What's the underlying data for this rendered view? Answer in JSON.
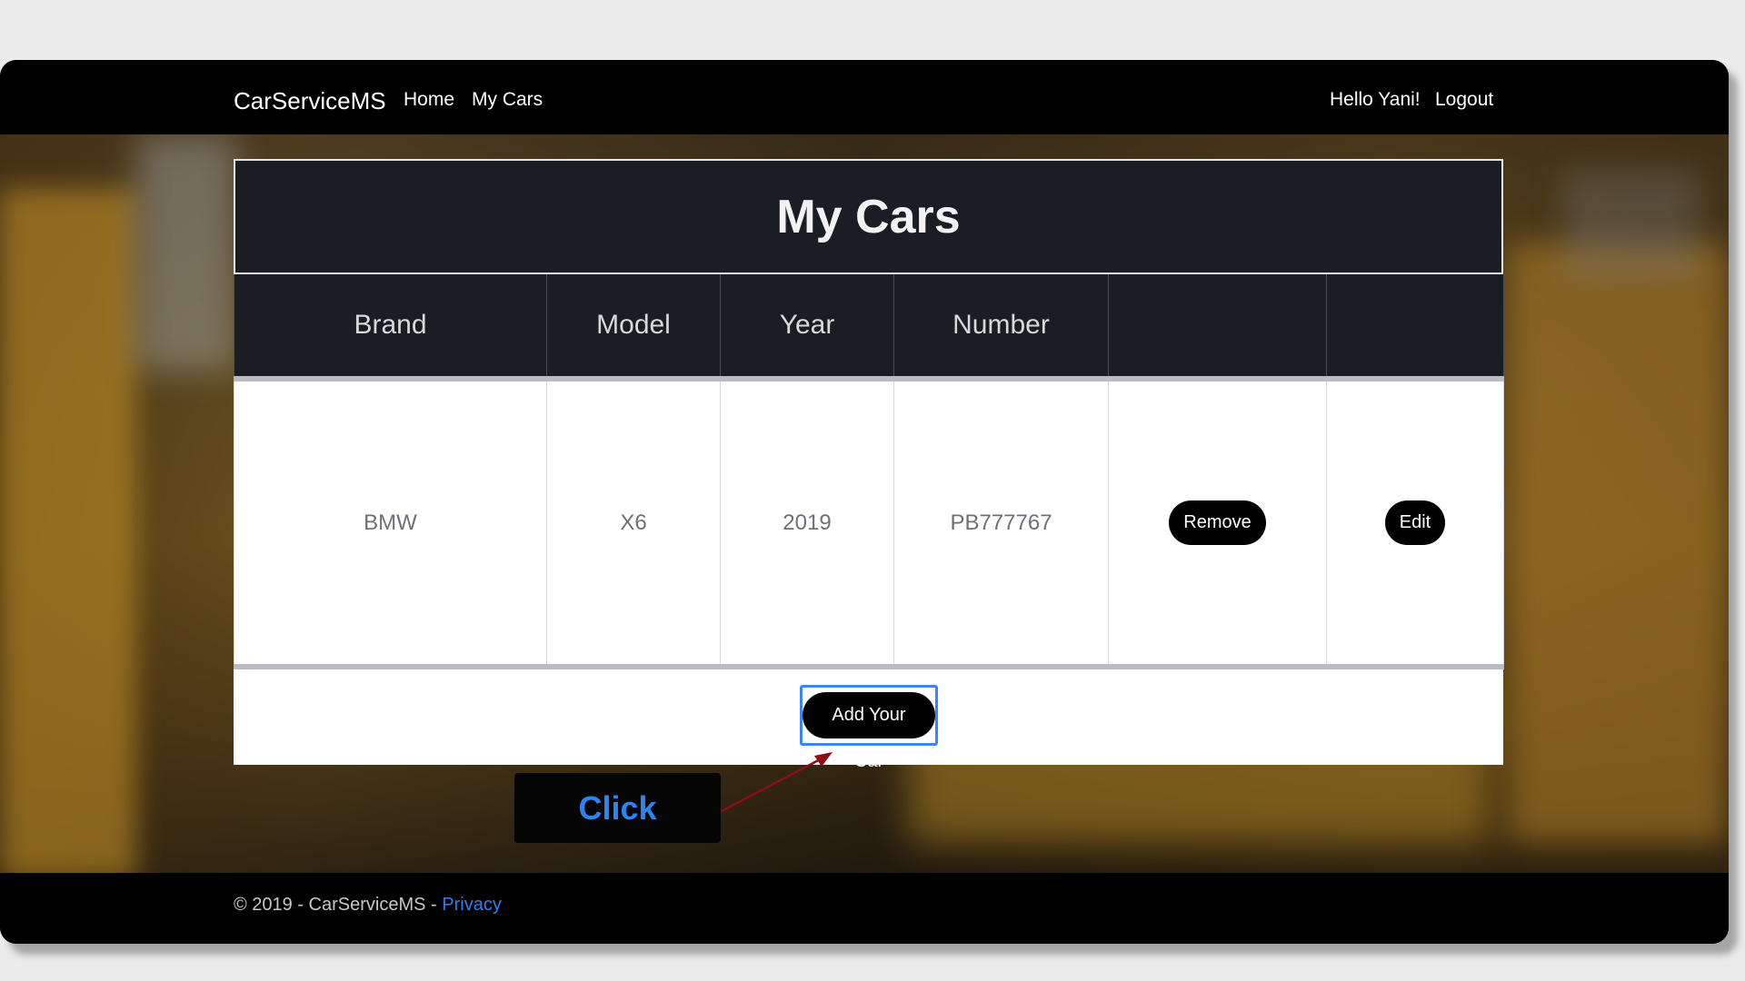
{
  "navbar": {
    "brand": "CarServiceMS",
    "links": [
      "Home",
      "My Cars"
    ],
    "greeting": "Hello Yani!",
    "logout": "Logout"
  },
  "panel": {
    "title": "My Cars",
    "columns": [
      "Brand",
      "Model",
      "Year",
      "Number",
      "",
      ""
    ],
    "rows": [
      {
        "brand": "BMW",
        "model": "X6",
        "year": "2019",
        "number": "PB777767",
        "remove_label": "Remove",
        "edit_label": "Edit"
      }
    ],
    "add_button": "Add Your Car"
  },
  "annotation": {
    "label": "Click"
  },
  "footer": {
    "copyright": "© 2019 - CarServiceMS - ",
    "privacy": "Privacy"
  },
  "colors": {
    "accent_blue": "#2f7ff0",
    "header_bg": "#1b1d24",
    "button_bg": "#000000"
  }
}
